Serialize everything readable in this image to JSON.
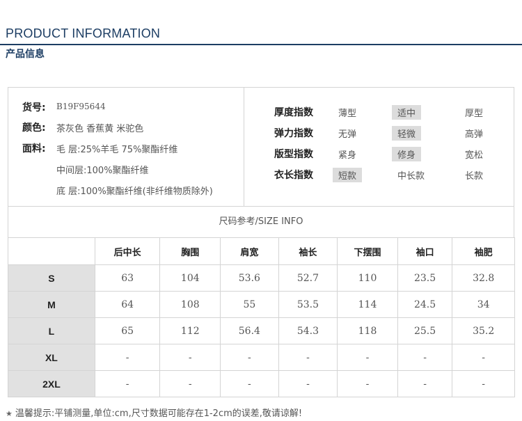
{
  "header": {
    "title_en": "PRODUCT INFORMATION",
    "title_cn": "产品信息"
  },
  "product": {
    "sku_label": "货号:",
    "sku_value": "B19F95644",
    "color_label": "颜色:",
    "color_value": "茶灰色 香蕉黄 米驼色",
    "fabric_label": "面料:",
    "fabric_lines": [
      "毛 层:25%羊毛 75%聚酯纤维",
      "中间层:100%聚酯纤维",
      "底 层:100%聚酯纤维(非纤维物质除外)"
    ]
  },
  "indices": [
    {
      "label": "厚度指数",
      "options": [
        "薄型",
        "适中",
        "厚型"
      ],
      "selected": 1
    },
    {
      "label": "弹力指数",
      "options": [
        "无弹",
        "轻微",
        "高弹"
      ],
      "selected": 1
    },
    {
      "label": "版型指数",
      "options": [
        "紧身",
        "修身",
        "宽松"
      ],
      "selected": 1
    },
    {
      "label": "衣长指数",
      "options": [
        "短款",
        "中长款",
        "长款"
      ],
      "selected": 0
    }
  ],
  "size_table": {
    "title": "尺码参考/SIZE INFO",
    "columns": [
      "后中长",
      "胸围",
      "肩宽",
      "袖长",
      "下摆围",
      "袖口",
      "袖肥"
    ],
    "rows": [
      {
        "size": "S",
        "values": [
          "63",
          "104",
          "53.6",
          "52.7",
          "110",
          "23.5",
          "32.8"
        ]
      },
      {
        "size": "M",
        "values": [
          "64",
          "108",
          "55",
          "53.5",
          "114",
          "24.5",
          "34"
        ]
      },
      {
        "size": "L",
        "values": [
          "65",
          "112",
          "56.4",
          "54.3",
          "118",
          "25.5",
          "35.2"
        ]
      },
      {
        "size": "XL",
        "values": [
          "-",
          "-",
          "-",
          "-",
          "-",
          "-",
          "-"
        ]
      },
      {
        "size": "2XL",
        "values": [
          "-",
          "-",
          "-",
          "-",
          "-",
          "-",
          "-"
        ]
      }
    ]
  },
  "note": {
    "star": "★",
    "text": "温馨提示:平铺测量,单位:cm,尺寸数据可能存在1-2cm的误差,敬请谅解!"
  },
  "colors": {
    "brand": "#1c3d63",
    "border": "#d4d4d4",
    "highlight": "#dcdcdc",
    "row_header_bg": "#e1e1e1"
  }
}
